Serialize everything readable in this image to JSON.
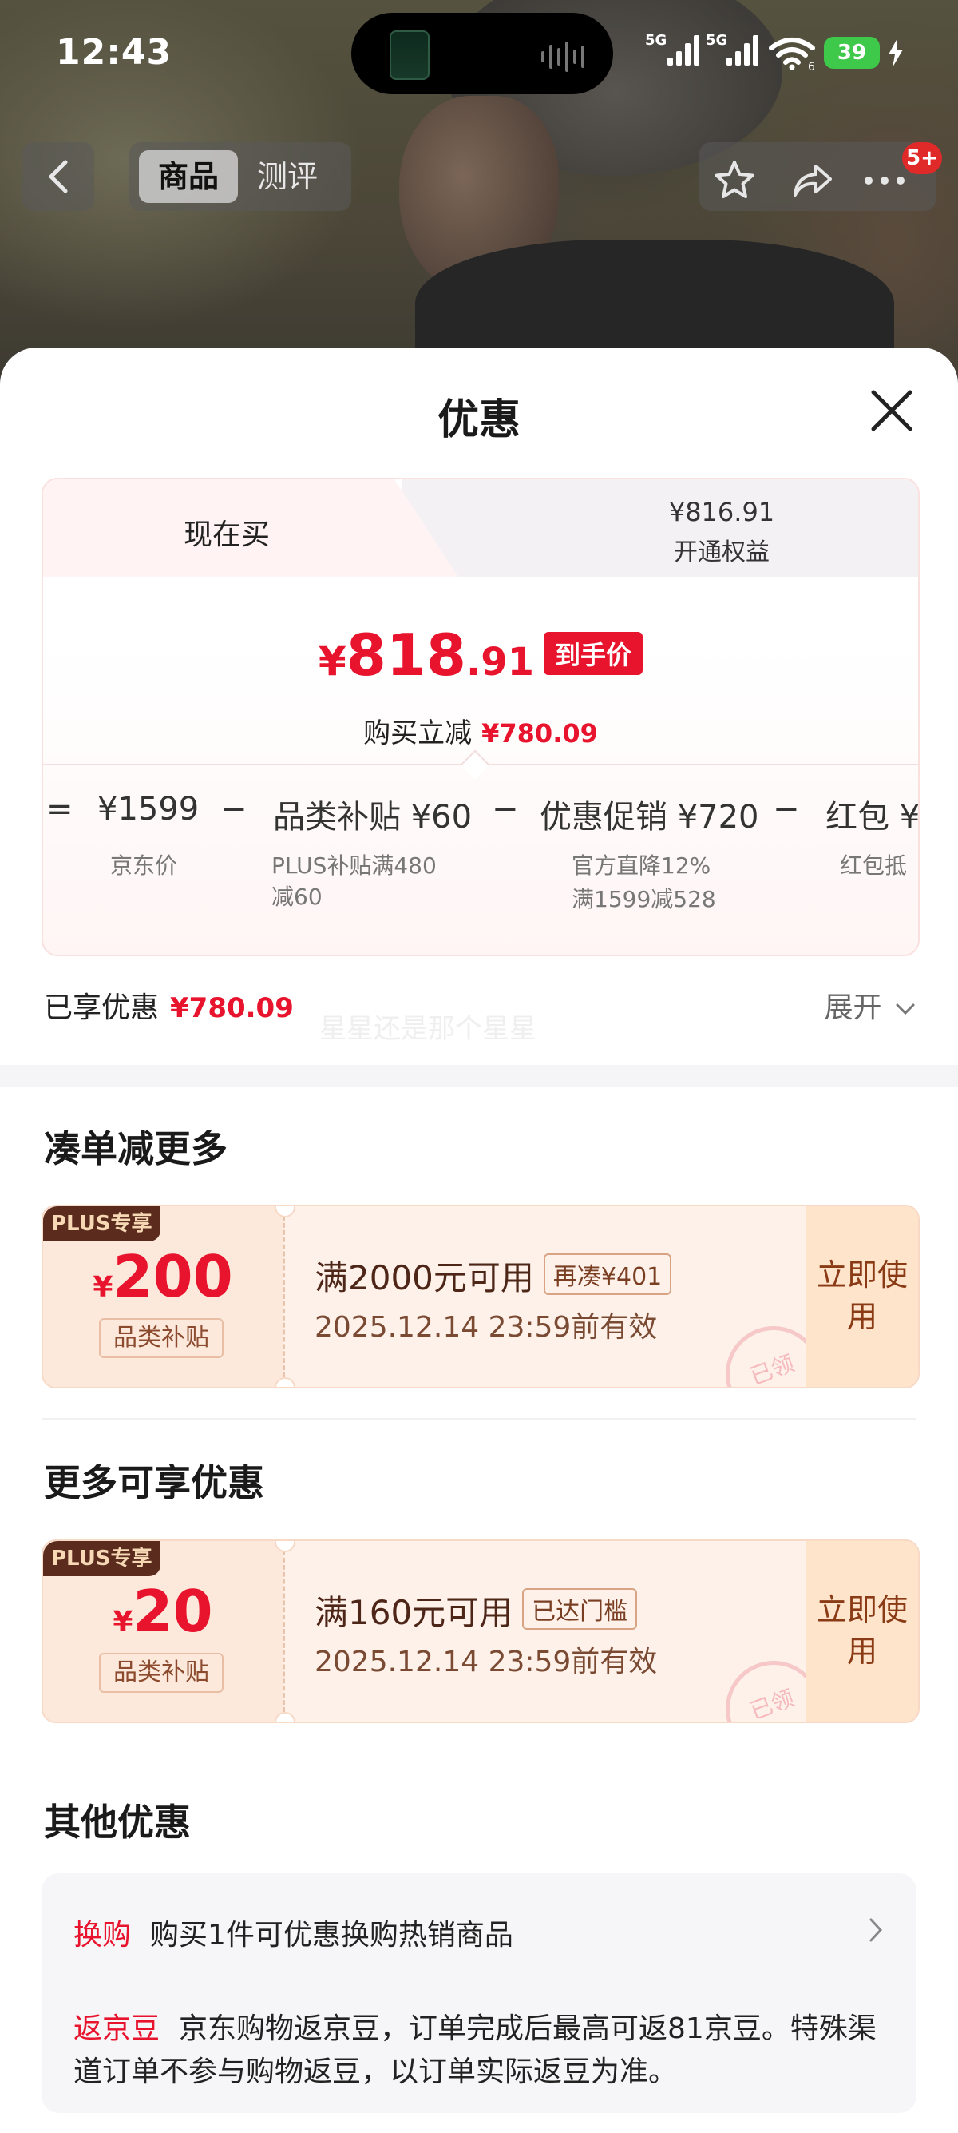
{
  "status_bar": {
    "time": "12:43",
    "signal_labels": [
      "5G",
      "5G"
    ],
    "wifi_label": "6",
    "battery": "39"
  },
  "nav": {
    "tabs": [
      "商品",
      "测评"
    ],
    "badge": "5+"
  },
  "sheet": {
    "title": "优惠"
  },
  "price_card": {
    "tab_now": "现在买",
    "tab_plus_price": "¥816.91",
    "tab_plus_label": "开通权益",
    "final_price_yen": "¥",
    "final_price_int": "818",
    "final_price_dec": ".91",
    "final_price_tag": "到手价",
    "reduce_label": "购买立减",
    "reduce_amount": "¥780.09",
    "calc": {
      "eq": "=",
      "jd_price": "¥1599",
      "jd_price_label": "京东价",
      "minus1": "−",
      "subsidy": "品类补贴 ¥60",
      "subsidy_note": "PLUS补贴满480\n减60",
      "minus2": "−",
      "promo": "优惠促销 ¥720",
      "promo_note1": "官方直降12%",
      "promo_note2": "满1599减528",
      "minus3": "−",
      "redpack": "红包 ¥",
      "redpack_note": "红包抵"
    }
  },
  "enjoyed": {
    "label": "已享优惠",
    "amount": "¥780.09",
    "expand": "展开",
    "watermark": "星星还是那个星星"
  },
  "section_more": {
    "title": "凑单减更多",
    "coupon": {
      "plus_tag": "PLUS专享",
      "yen": "¥",
      "amount": "200",
      "type": "品类补贴",
      "condition": "满2000元可用",
      "pill": "再凑¥401",
      "date": "2025.12.14 23:59前有效",
      "button": "立即使用",
      "stamp": "已领"
    }
  },
  "section_available": {
    "title": "更多可享优惠",
    "coupon": {
      "plus_tag": "PLUS专享",
      "yen": "¥",
      "amount": "20",
      "type": "品类补贴",
      "condition": "满160元可用",
      "pill": "已达门槛",
      "date": "2025.12.14 23:59前有效",
      "button": "立即使用",
      "stamp": "已领"
    }
  },
  "section_other": {
    "title": "其他优惠",
    "row1_key": "换购",
    "row1_text": "购买1件可优惠换购热销商品",
    "row2_key": "返京豆",
    "row2_text": "京东购物返京豆，订单完成后最高可返81京豆。特殊渠道订单不参与购物返豆，以订单实际返豆为准。"
  },
  "colors": {
    "accent_red": "#e8132d",
    "coupon_bg": "#fdf1ea",
    "coupon_button_bg": "#ffe4cc",
    "battery_green": "#3fc94a"
  }
}
